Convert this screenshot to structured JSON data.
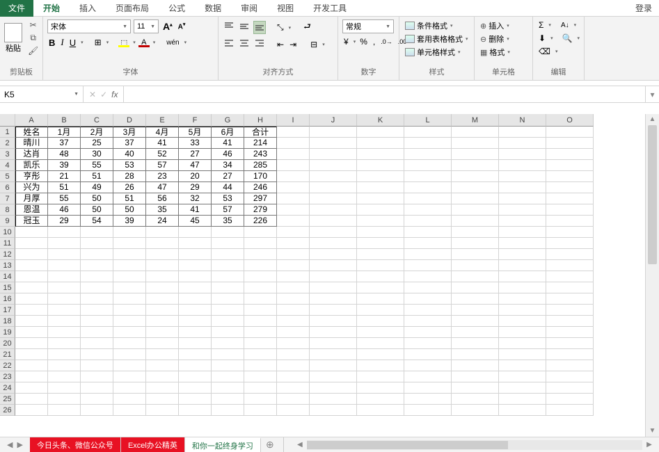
{
  "tabs": {
    "file": "文件",
    "items": [
      "开始",
      "插入",
      "页面布局",
      "公式",
      "数据",
      "审阅",
      "视图",
      "开发工具"
    ],
    "active": 0,
    "login": "登录"
  },
  "ribbon": {
    "clipboard": {
      "paste": "粘贴",
      "label": "剪贴板"
    },
    "font": {
      "name": "宋体",
      "size": "11",
      "label": "字体",
      "wen": "wén"
    },
    "align": {
      "label": "对齐方式"
    },
    "number": {
      "format": "常规",
      "label": "数字"
    },
    "styles": {
      "cond": "条件格式",
      "tablefmt": "套用表格格式",
      "cellstyle": "单元格样式",
      "label": "样式"
    },
    "cells": {
      "insert": "插入",
      "delete": "删除",
      "format": "格式",
      "label": "单元格"
    },
    "edit": {
      "label": "编辑"
    }
  },
  "namebox": "K5",
  "columns": [
    "A",
    "B",
    "C",
    "D",
    "E",
    "F",
    "G",
    "H",
    "I",
    "J",
    "K",
    "L",
    "M",
    "N",
    "O"
  ],
  "row_count": 26,
  "data_rows": 9,
  "data_cols": 8,
  "cells": [
    [
      "姓名",
      "1月",
      "2月",
      "3月",
      "4月",
      "5月",
      "6月",
      "合计"
    ],
    [
      "晴川",
      "37",
      "25",
      "37",
      "41",
      "33",
      "41",
      "214"
    ],
    [
      "达肖",
      "48",
      "30",
      "40",
      "52",
      "27",
      "46",
      "243"
    ],
    [
      "凯乐",
      "39",
      "55",
      "53",
      "57",
      "47",
      "34",
      "285"
    ],
    [
      "亨彤",
      "21",
      "51",
      "28",
      "23",
      "20",
      "27",
      "170"
    ],
    [
      "兴为",
      "51",
      "49",
      "26",
      "47",
      "29",
      "44",
      "246"
    ],
    [
      "月厚",
      "55",
      "50",
      "51",
      "56",
      "32",
      "53",
      "297"
    ],
    [
      "恩温",
      "46",
      "50",
      "50",
      "35",
      "41",
      "57",
      "279"
    ],
    [
      "冠玉",
      "29",
      "54",
      "39",
      "24",
      "45",
      "35",
      "226"
    ]
  ],
  "sheets": {
    "tabs": [
      "今日头条、微信公众号",
      "Excel办公精英",
      "和你一起终身学习"
    ],
    "red": [
      0,
      1
    ],
    "active": 2
  }
}
